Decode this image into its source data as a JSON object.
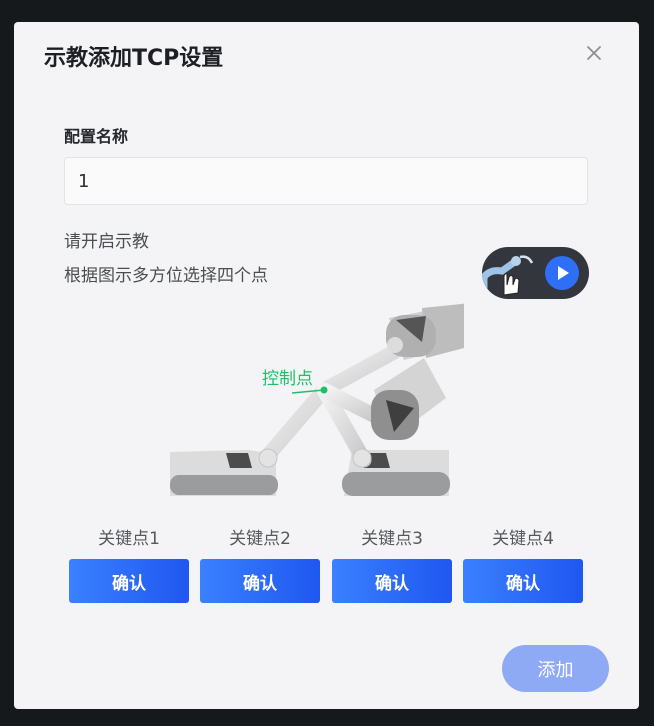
{
  "dialog": {
    "title": "示教添加TCP设置",
    "close_icon": "close-icon"
  },
  "config": {
    "label": "配置名称",
    "value": "1"
  },
  "hints": {
    "line1": "请开启示教",
    "line2": "根据图示多方位选择四个点"
  },
  "illustration": {
    "control_point_label": "控制点",
    "accent_color": "#1fbf6a"
  },
  "keypoints": [
    {
      "label": "关键点1",
      "button": "确认"
    },
    {
      "label": "关键点2",
      "button": "确认"
    },
    {
      "label": "关键点3",
      "button": "确认"
    },
    {
      "label": "关键点4",
      "button": "确认"
    }
  ],
  "footer": {
    "add_label": "添加"
  },
  "colors": {
    "primary": "#2f6ef6",
    "add_disabled": "#8eaaf4",
    "modal_bg": "#f4f4f6",
    "overlay": "#16191c"
  }
}
